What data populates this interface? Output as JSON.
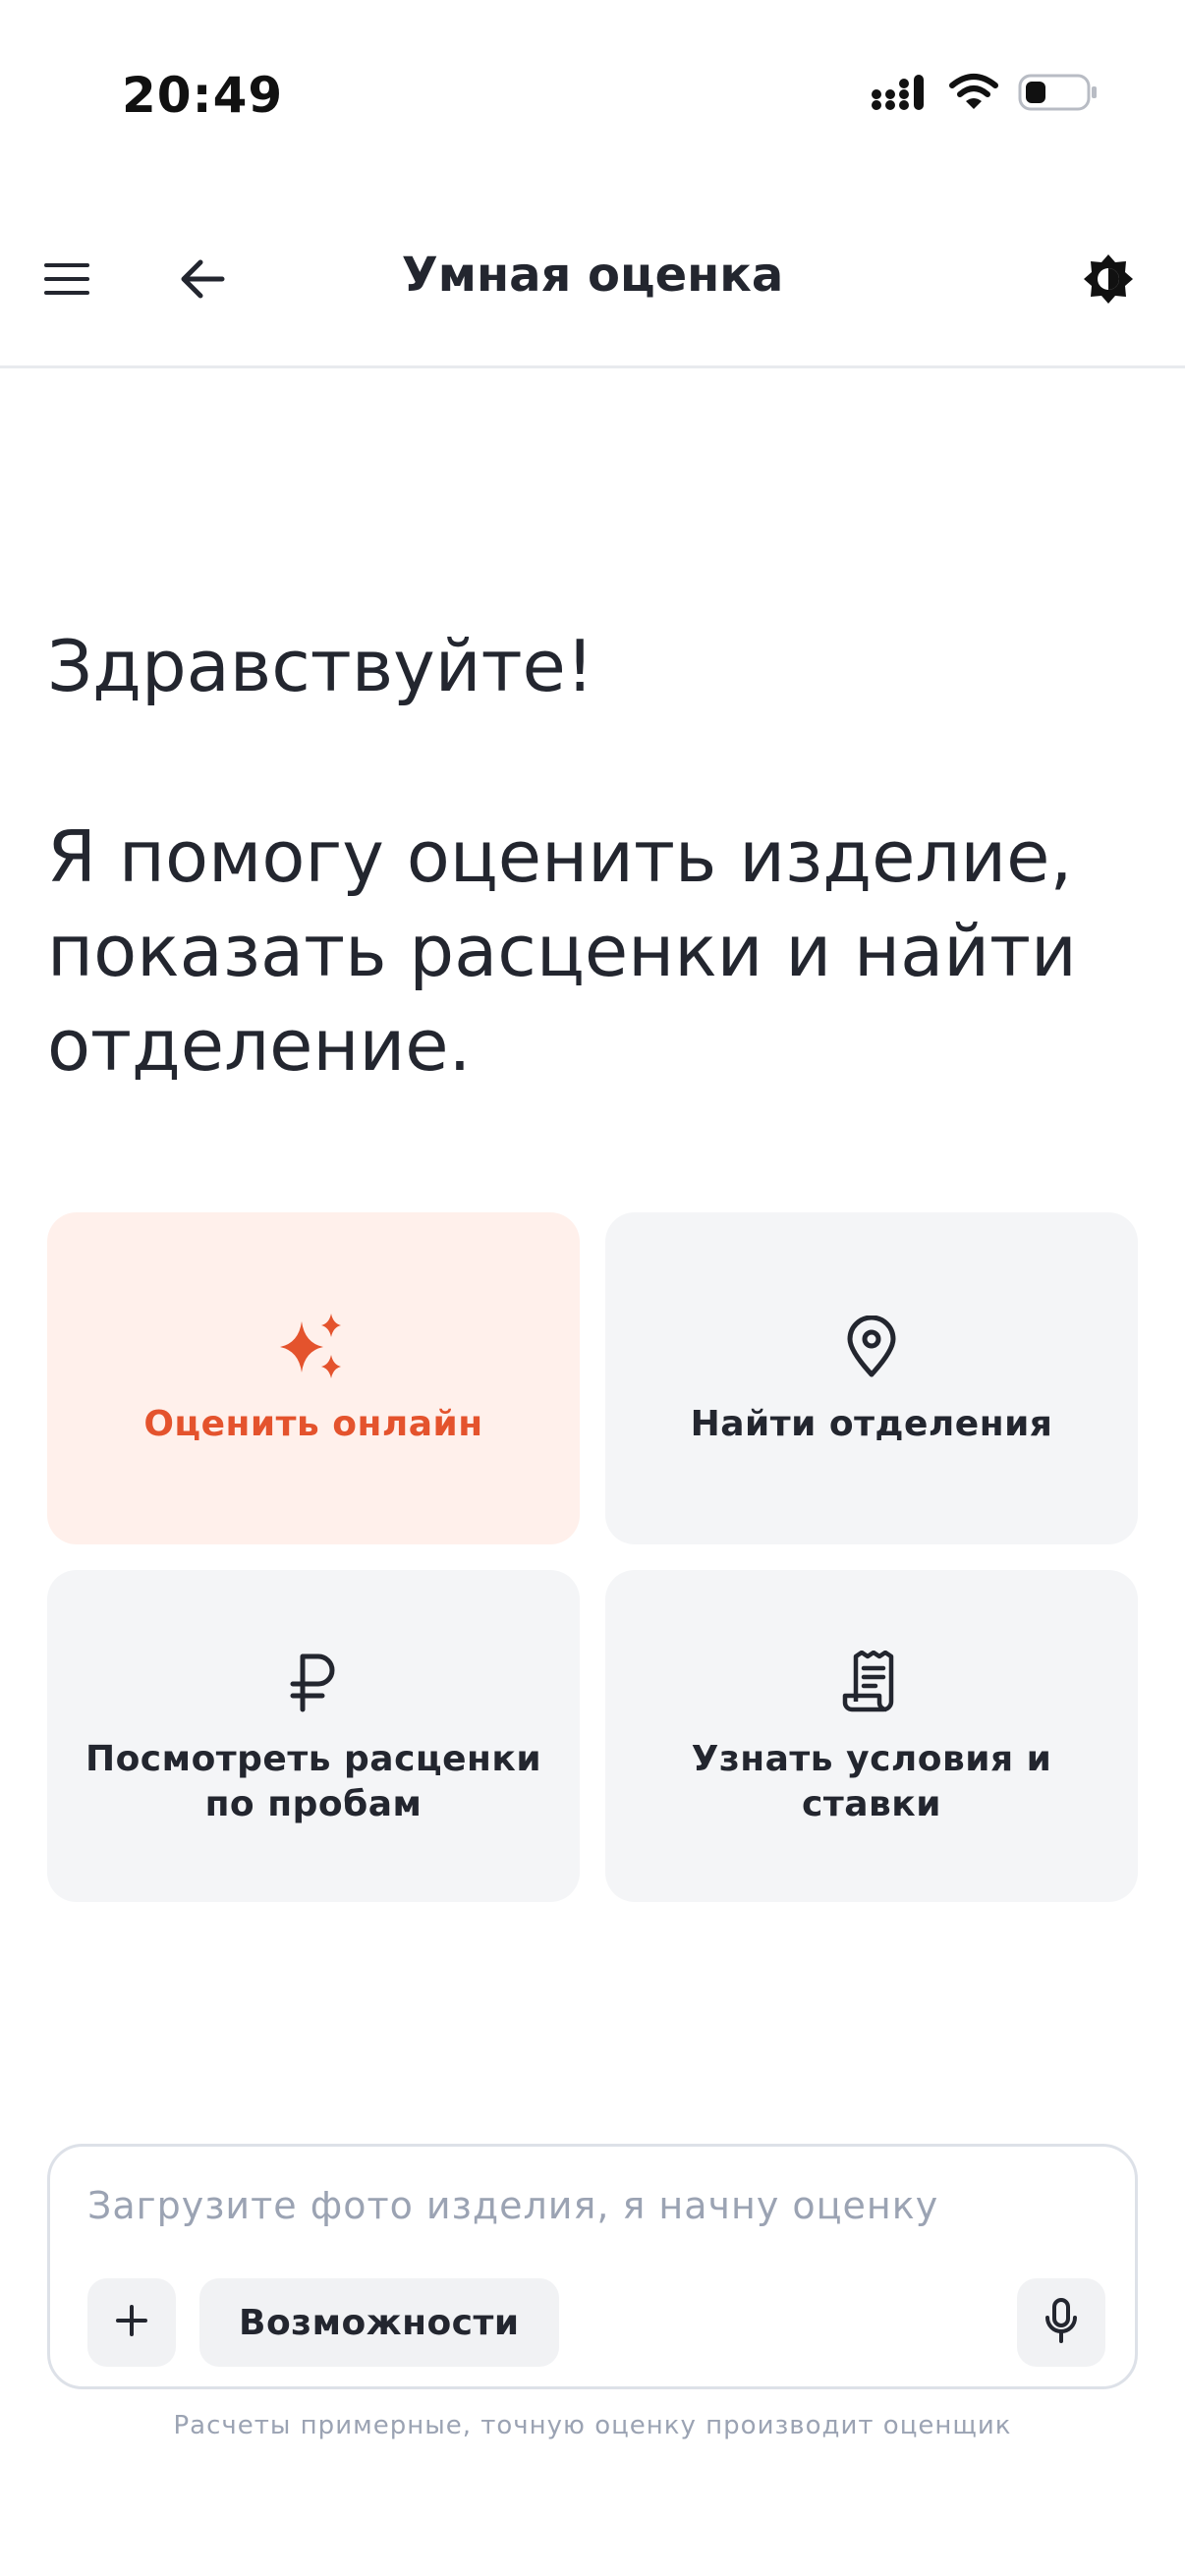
{
  "status_bar": {
    "time": "20:49",
    "icons": [
      "cellular-signal-icon",
      "wifi-icon",
      "battery-icon"
    ]
  },
  "header": {
    "title": "Умная оценка",
    "icons": [
      "menu-icon",
      "arrow-left-icon",
      "theme-toggle-icon"
    ]
  },
  "welcome": {
    "greeting": "Здравствуйте!",
    "intro": "Я помогу оценить изделие, показать расценки и найти отделение."
  },
  "actions": [
    {
      "label": "Оценить онлайн",
      "icon": "sparkles-icon",
      "highlighted": true
    },
    {
      "label": "Найти отделения",
      "icon": "map-pin-icon",
      "highlighted": false
    },
    {
      "label": "Посмотреть расценки по пробам",
      "icon": "ruble-icon",
      "highlighted": false
    },
    {
      "label": "Узнать условия и ставки",
      "icon": "receipt-icon",
      "highlighted": false
    }
  ],
  "composer": {
    "placeholder": "Загрузите фото изделия, я начну оценку",
    "value": "",
    "features_label": "Возможности",
    "icons": [
      "plus-icon",
      "microphone-icon"
    ]
  },
  "disclaimer": "Расчеты примерные, точную оценку производит оценщик",
  "colors": {
    "accent": "#e4532d",
    "accent_bg": "#fff0eb",
    "card_bg": "#f4f5f7",
    "text": "#23262f",
    "muted": "#9ba3b3"
  }
}
